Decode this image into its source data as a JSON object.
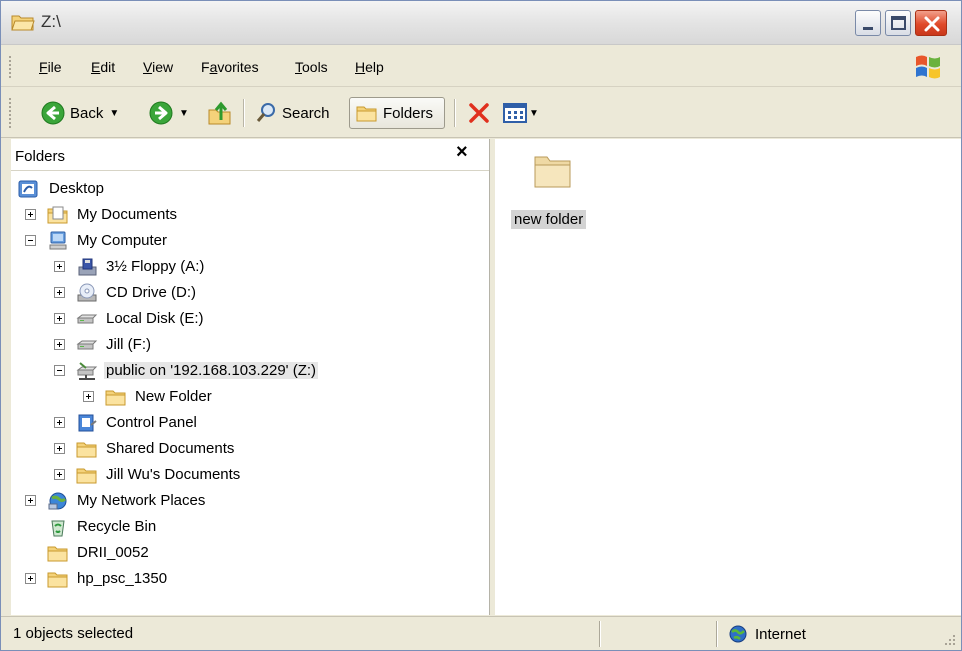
{
  "window": {
    "title": "Z:\\"
  },
  "menu": {
    "items": [
      {
        "key": "F",
        "rest": "ile"
      },
      {
        "key": "E",
        "rest": "dit"
      },
      {
        "key": "V",
        "rest": "iew"
      },
      {
        "key_pre": "F",
        "key": "a",
        "rest": "vorites"
      },
      {
        "key": "T",
        "rest": "ools"
      },
      {
        "key": "H",
        "rest": "elp"
      }
    ]
  },
  "toolbar": {
    "back_label": "Back",
    "search_label": "Search",
    "folders_label": "Folders"
  },
  "folders_pane": {
    "title": "Folders",
    "close_glyph": "×",
    "tree": [
      {
        "label": "Desktop",
        "icon": "desktop-icon"
      },
      {
        "label": "My Documents",
        "icon": "my-documents-icon",
        "expander": "plus"
      },
      {
        "label": "My Computer",
        "icon": "my-computer-icon",
        "expander": "minus"
      },
      {
        "label": "3½ Floppy (A:)",
        "icon": "floppy-drive-icon",
        "expander": "plus"
      },
      {
        "label": "CD Drive (D:)",
        "icon": "cd-drive-icon",
        "expander": "plus"
      },
      {
        "label": "Local Disk (E:)",
        "icon": "hard-disk-icon",
        "expander": "plus"
      },
      {
        "label": "Jill (F:)",
        "icon": "hard-disk-icon",
        "expander": "plus"
      },
      {
        "label": "public on '192.168.103.229' (Z:)",
        "icon": "network-drive-icon",
        "expander": "minus",
        "selected": true
      },
      {
        "label": "New Folder",
        "icon": "folder-icon",
        "expander": "plus"
      },
      {
        "label": "Control Panel",
        "icon": "control-panel-icon",
        "expander": "plus"
      },
      {
        "label": "Shared Documents",
        "icon": "folder-icon",
        "expander": "plus"
      },
      {
        "label": "Jill Wu's Documents",
        "icon": "folder-icon",
        "expander": "plus"
      },
      {
        "label": "My Network Places",
        "icon": "network-places-icon",
        "expander": "plus"
      },
      {
        "label": "Recycle Bin",
        "icon": "recycle-bin-icon"
      },
      {
        "label": "DRII_0052",
        "icon": "folder-icon"
      },
      {
        "label": "hp_psc_1350",
        "icon": "folder-icon",
        "expander": "plus"
      }
    ]
  },
  "content": {
    "items": [
      {
        "label": "new folder",
        "icon": "folder-icon",
        "selected": true
      }
    ]
  },
  "status": {
    "left_text": "1 objects selected",
    "zone_label": "Internet"
  },
  "colors": {
    "folder_yellow": "#f4d27a",
    "close_red": "#e04a2a",
    "selection_gray": "#d3d3d3"
  }
}
